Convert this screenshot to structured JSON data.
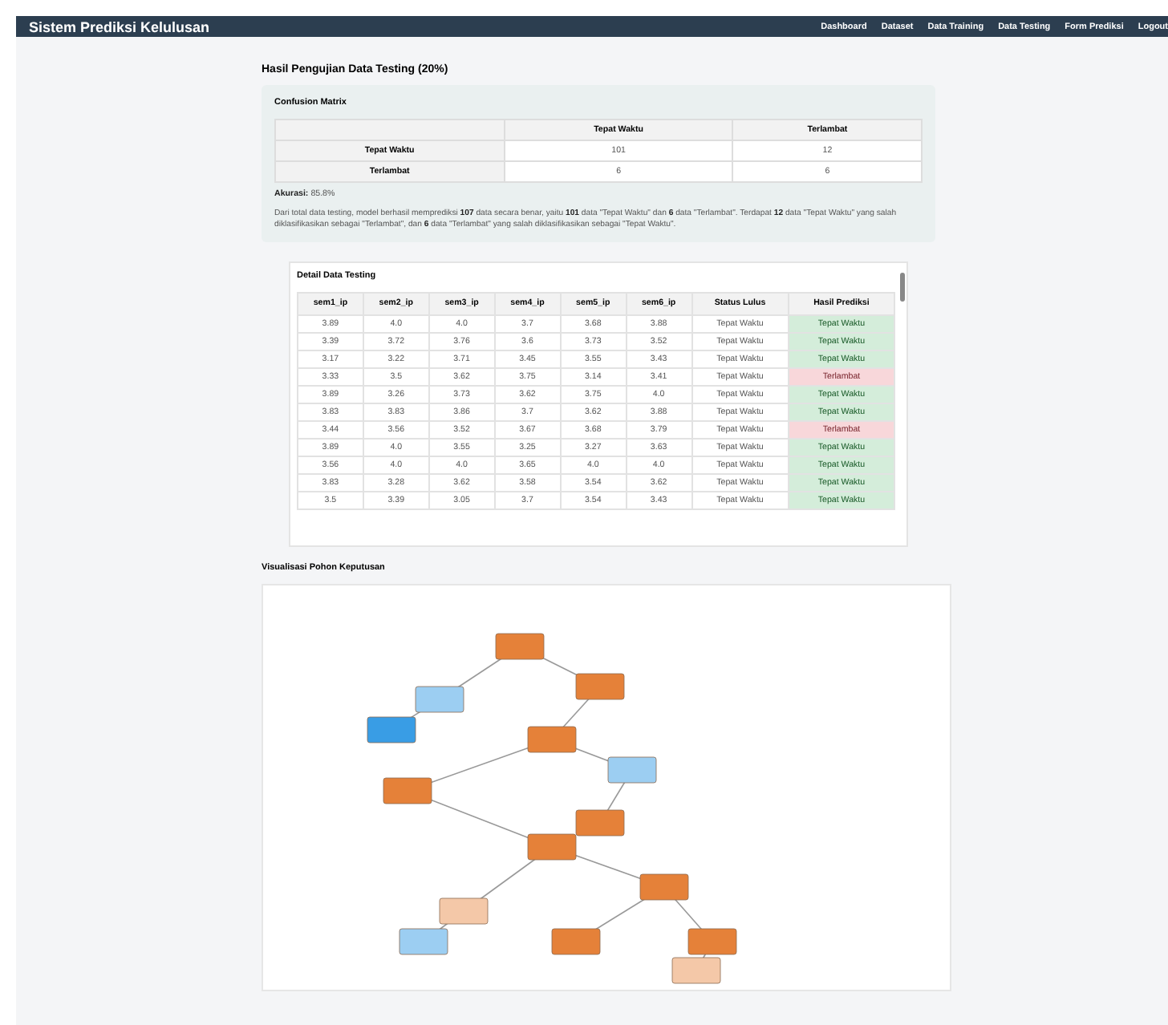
{
  "navbar": {
    "brand": "Sistem Prediksi Kelulusan",
    "links": [
      "Dashboard",
      "Dataset",
      "Data Training",
      "Data Testing",
      "Form Prediksi",
      "Logout"
    ]
  },
  "page_title": "Hasil Pengujian Data Testing (20%)",
  "confusion_matrix": {
    "title": "Confusion Matrix",
    "columns": [
      "Tepat Waktu",
      "Terlambat"
    ],
    "rows": [
      {
        "label": "Tepat Waktu",
        "values": [
          "101",
          "12"
        ]
      },
      {
        "label": "Terlambat",
        "values": [
          "6",
          "6"
        ]
      }
    ],
    "accuracy_label": "Akurasi:",
    "accuracy": "85.8%",
    "description": "Dari total data testing, model berhasil memprediksi **107** data secara benar, yaitu **101** data \"Tepat Waktu\" dan **6** data \"Terlambat\". Terdapat **12** data \"Tepat Waktu\" yang salah diklasifikasikan sebagai \"Terlambat\", dan **6** data \"Terlambat\" yang salah diklasifikasikan sebagai \"Tepat Waktu\"."
  },
  "detail": {
    "title": "Detail Data Testing",
    "columns": [
      "sem1_ip",
      "sem2_ip",
      "sem3_ip",
      "sem4_ip",
      "sem5_ip",
      "sem6_ip",
      "Status Lulus",
      "Hasil Prediksi"
    ],
    "rows": [
      {
        "values": [
          "3.89",
          "4.0",
          "4.0",
          "3.7",
          "3.68",
          "3.88"
        ],
        "status": "Tepat Waktu",
        "prediction": "Tepat Waktu",
        "correct": true
      },
      {
        "values": [
          "3.39",
          "3.72",
          "3.76",
          "3.6",
          "3.73",
          "3.52"
        ],
        "status": "Tepat Waktu",
        "prediction": "Tepat Waktu",
        "correct": true
      },
      {
        "values": [
          "3.17",
          "3.22",
          "3.71",
          "3.45",
          "3.55",
          "3.43"
        ],
        "status": "Tepat Waktu",
        "prediction": "Tepat Waktu",
        "correct": true
      },
      {
        "values": [
          "3.33",
          "3.5",
          "3.62",
          "3.75",
          "3.14",
          "3.41"
        ],
        "status": "Tepat Waktu",
        "prediction": "Terlambat",
        "correct": false
      },
      {
        "values": [
          "3.89",
          "3.26",
          "3.73",
          "3.62",
          "3.75",
          "4.0"
        ],
        "status": "Tepat Waktu",
        "prediction": "Tepat Waktu",
        "correct": true
      },
      {
        "values": [
          "3.83",
          "3.83",
          "3.86",
          "3.7",
          "3.62",
          "3.88"
        ],
        "status": "Tepat Waktu",
        "prediction": "Tepat Waktu",
        "correct": true
      },
      {
        "values": [
          "3.44",
          "3.56",
          "3.52",
          "3.67",
          "3.68",
          "3.79"
        ],
        "status": "Tepat Waktu",
        "prediction": "Terlambat",
        "correct": false
      },
      {
        "values": [
          "3.89",
          "4.0",
          "3.55",
          "3.25",
          "3.27",
          "3.63"
        ],
        "status": "Tepat Waktu",
        "prediction": "Tepat Waktu",
        "correct": true
      },
      {
        "values": [
          "3.56",
          "4.0",
          "4.0",
          "3.65",
          "4.0",
          "4.0"
        ],
        "status": "Tepat Waktu",
        "prediction": "Tepat Waktu",
        "correct": true
      },
      {
        "values": [
          "3.83",
          "3.28",
          "3.62",
          "3.58",
          "3.54",
          "3.62"
        ],
        "status": "Tepat Waktu",
        "prediction": "Tepat Waktu",
        "correct": true
      },
      {
        "values": [
          "3.5",
          "3.39",
          "3.05",
          "3.7",
          "3.54",
          "3.43"
        ],
        "status": "Tepat Waktu",
        "prediction": "Tepat Waktu",
        "correct": true
      }
    ]
  },
  "tree": {
    "title": "Visualisasi Pohon Keputusan",
    "kind": "picture"
  }
}
